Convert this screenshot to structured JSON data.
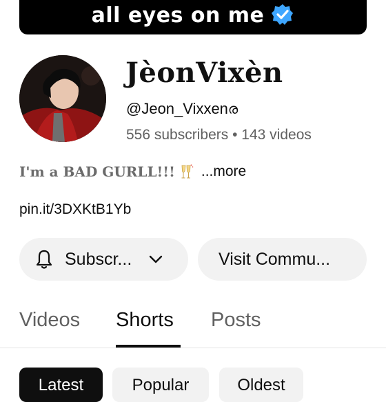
{
  "banner": {
    "text": "all eyes on me"
  },
  "channel": {
    "name": "JèonVixèn",
    "handle": "@Jeon_Vixxen",
    "handle_glyph": "ര",
    "subscribers": "556 subscribers",
    "separator": "•",
    "videos": "143 videos"
  },
  "bio": {
    "text": "I'm a BAD GURLL!!!",
    "more_label": "...more",
    "emoji": "champagne-toast"
  },
  "link": {
    "text": "pin.it/3DXKtB1Yb"
  },
  "buttons": {
    "subscribe_label": "Subscr...",
    "visit_label": "Visit Commu..."
  },
  "tabs": [
    {
      "label": "Videos",
      "active": false
    },
    {
      "label": "Shorts",
      "active": true
    },
    {
      "label": "Posts",
      "active": false
    }
  ],
  "chips": [
    {
      "label": "Latest",
      "active": true
    },
    {
      "label": "Popular",
      "active": false
    },
    {
      "label": "Oldest",
      "active": false
    }
  ],
  "colors": {
    "accent_blue": "#3ea6ff",
    "text_secondary": "#606060",
    "chip_bg": "#f2f2f2"
  }
}
